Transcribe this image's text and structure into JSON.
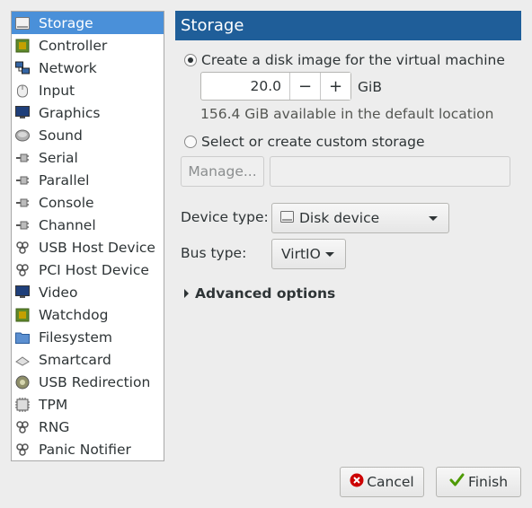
{
  "sidebar": {
    "items": [
      {
        "label": "Storage",
        "icon": "storage-icon"
      },
      {
        "label": "Controller",
        "icon": "controller-icon"
      },
      {
        "label": "Network",
        "icon": "network-icon"
      },
      {
        "label": "Input",
        "icon": "mouse-icon"
      },
      {
        "label": "Graphics",
        "icon": "monitor-icon"
      },
      {
        "label": "Sound",
        "icon": "speaker-icon"
      },
      {
        "label": "Serial",
        "icon": "serial-plug-icon"
      },
      {
        "label": "Parallel",
        "icon": "parallel-plug-icon"
      },
      {
        "label": "Console",
        "icon": "console-plug-icon"
      },
      {
        "label": "Channel",
        "icon": "channel-plug-icon"
      },
      {
        "label": "USB Host Device",
        "icon": "usb-device-icon"
      },
      {
        "label": "PCI Host Device",
        "icon": "pci-device-icon"
      },
      {
        "label": "Video",
        "icon": "video-monitor-icon"
      },
      {
        "label": "Watchdog",
        "icon": "watchdog-chip-icon"
      },
      {
        "label": "Filesystem",
        "icon": "folder-icon"
      },
      {
        "label": "Smartcard",
        "icon": "smartcard-icon"
      },
      {
        "label": "USB Redirection",
        "icon": "usb-redirection-icon"
      },
      {
        "label": "TPM",
        "icon": "tpm-chip-icon"
      },
      {
        "label": "RNG",
        "icon": "rng-device-icon"
      },
      {
        "label": "Panic Notifier",
        "icon": "panic-device-icon"
      }
    ],
    "selected_index": 0
  },
  "header": {
    "title": "Storage"
  },
  "storage": {
    "create_label": "Create a disk image for the virtual machine",
    "size_value": "20.0",
    "minus_label": "−",
    "plus_label": "+",
    "size_unit": "GiB",
    "available_text": "156.4 GiB available in the default location",
    "custom_label": "Select or create custom storage",
    "manage_label": "Manage...",
    "custom_path_value": ""
  },
  "device_type": {
    "label": "Device type:",
    "value": "Disk device"
  },
  "bus_type": {
    "label": "Bus type:",
    "value": "VirtIO"
  },
  "advanced": {
    "label": "Advanced options"
  },
  "footer": {
    "cancel_label": "Cancel",
    "finish_label": "Finish"
  },
  "colors": {
    "selection": "#4a90d9",
    "header": "#1f5e99",
    "cancel_icon": "#cc0000",
    "finish_icon": "#4e9a06"
  }
}
